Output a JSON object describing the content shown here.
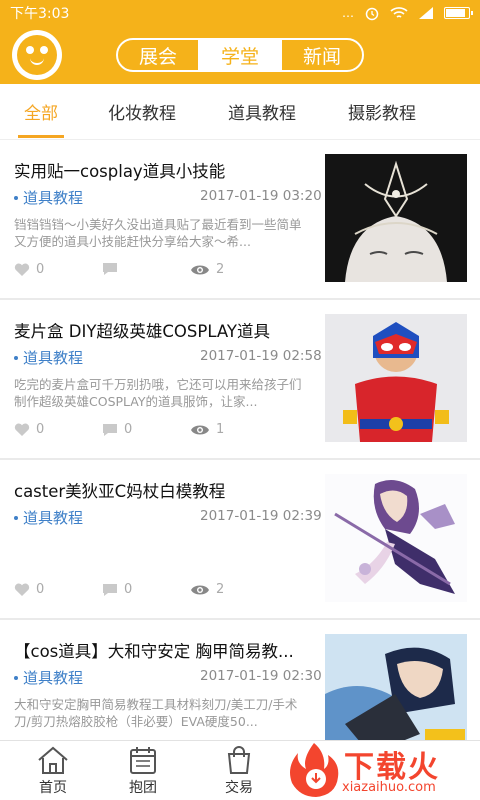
{
  "status": {
    "time": "下午3:03",
    "signal_text": "…",
    "battery_pct": 85
  },
  "header": {
    "tabs": [
      "展会",
      "学堂",
      "新闻"
    ],
    "active_tab_index": 1,
    "accent_color": "#f5b21a"
  },
  "category_tabs": [
    "全部",
    "化妆教程",
    "道具教程",
    "摄影教程"
  ],
  "active_category_index": 0,
  "articles": [
    {
      "title": "实用贴一cosplay道具小技能",
      "category": "道具教程",
      "time": "2017-01-19 03:20",
      "desc": "铛铛铛铛～小美好久没出道具贴了最近看到一些简单又方便的道具小技能赶快分享给大家～希...",
      "likes": "0",
      "comments": "",
      "views": "2",
      "thumb": "headpiece-photo"
    },
    {
      "title": "麦片盒 DIY超级英雄COSPLAY道具",
      "category": "道具教程",
      "time": "2017-01-19 02:58",
      "desc": "吃完的麦片盒可千万别扔哦，它还可以用来给孩子们制作超级英雄COSPLAY的道具服饰，让家...",
      "likes": "0",
      "comments": "0",
      "views": "1",
      "thumb": "superhero-kid-photo"
    },
    {
      "title": "caster美狄亚C妈杖白模教程",
      "category": "道具教程",
      "time": "2017-01-19 02:39",
      "desc": "",
      "likes": "0",
      "comments": "0",
      "views": "2",
      "thumb": "anime-character-art"
    },
    {
      "title": "【cos道具】大和守安定 胸甲简易教...",
      "category": "道具教程",
      "time": "2017-01-19 02:30",
      "desc": "大和守安定胸甲简易教程工具材料刻刀/美工刀/手术刀/剪刀热熔胶胶枪（非必要）EVA硬度50...",
      "likes": "",
      "comments": "",
      "views": "",
      "thumb": "cosplay-armor-photo"
    }
  ],
  "bottom_nav": [
    {
      "label": "首页",
      "icon": "home-icon"
    },
    {
      "label": "抱团",
      "icon": "calendar-icon"
    },
    {
      "label": "交易",
      "icon": "shopping-bag-icon"
    }
  ],
  "watermark": {
    "main": "下载火",
    "sub": "xiazaihuo.com"
  }
}
